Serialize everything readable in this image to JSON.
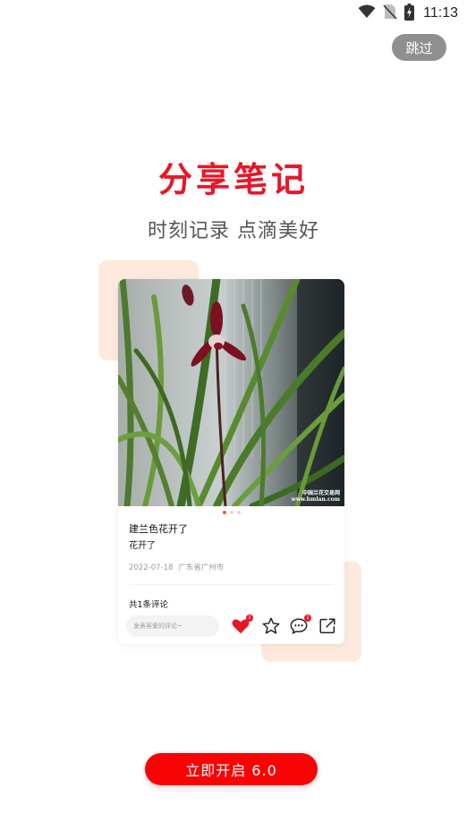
{
  "status_bar": {
    "time": "11:13",
    "icons": [
      "wifi-icon",
      "no-sim-icon",
      "battery-charging-icon"
    ]
  },
  "skip_button": {
    "label": "跳过"
  },
  "headline": "分享笔记",
  "subheadline": "时刻记录  点滴美好",
  "preview_card": {
    "photo": {
      "subject": "orchid-flower",
      "watermark_line1": "中国兰花交易网",
      "watermark_line2": "www.hmlan.com"
    },
    "pager": {
      "count": 3,
      "active": 0
    },
    "title": "建兰色花开了",
    "body": "花开了",
    "date": "2022-07-18",
    "location": "广东省广州市",
    "comments_count": "共1条评论",
    "comment_placeholder": "发表客爱的评论~",
    "actions": [
      {
        "icon": "heart-icon",
        "badge": "1",
        "active": true
      },
      {
        "icon": "star-icon",
        "badge": ""
      },
      {
        "icon": "comment-icon",
        "badge": "1"
      },
      {
        "icon": "share-icon",
        "badge": ""
      }
    ]
  },
  "colors": {
    "accent": "#e5182a",
    "button": "#f80404",
    "deco": "#fde9dd"
  },
  "start_button": {
    "label": "立即开启 6.0"
  }
}
